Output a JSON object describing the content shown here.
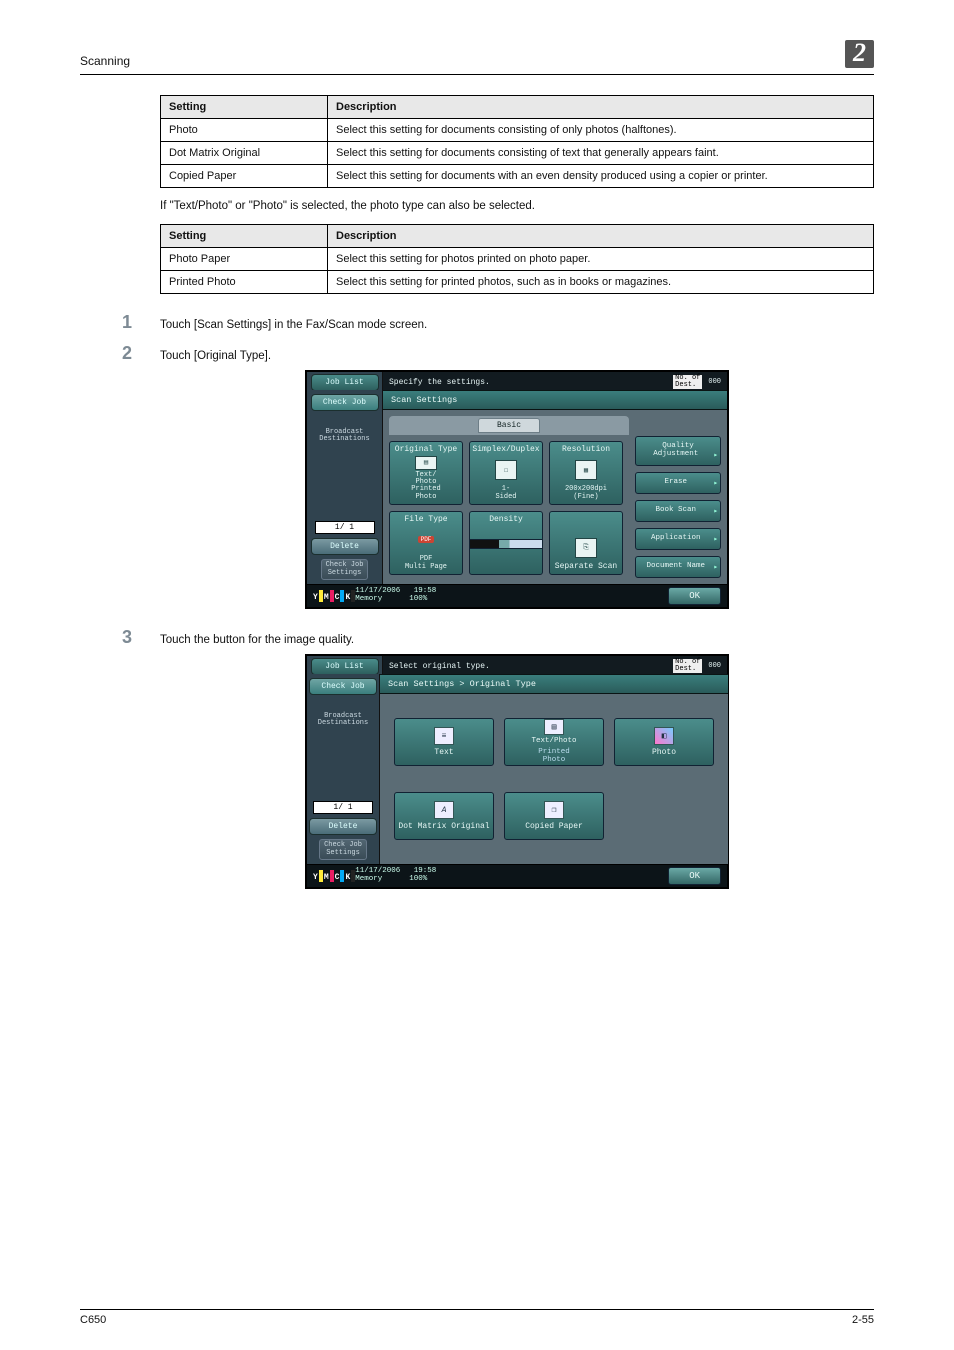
{
  "header": {
    "section": "Scanning",
    "chapter_number": "2"
  },
  "table1": {
    "cols": [
      "Setting",
      "Description"
    ],
    "rows": [
      [
        "Photo",
        "Select this setting for documents consisting of only photos (halftones)."
      ],
      [
        "Dot Matrix Original",
        "Select this setting for documents consisting of text that generally appears faint."
      ],
      [
        "Copied Paper",
        "Select this setting for documents with an even density produced using a copier or printer."
      ]
    ]
  },
  "mid_paragraph": "If \"Text/Photo\" or \"Photo\" is selected, the photo type can also be selected.",
  "table2": {
    "cols": [
      "Setting",
      "Description"
    ],
    "rows": [
      [
        "Photo Paper",
        "Select this setting for photos printed on photo paper."
      ],
      [
        "Printed Photo",
        "Select this setting for printed photos, such as in books or magazines."
      ]
    ]
  },
  "steps": {
    "s1": {
      "num": "1",
      "text": "Touch [Scan Settings] in the Fax/Scan mode screen."
    },
    "s2": {
      "num": "2",
      "text": "Touch [Original Type]."
    },
    "s3": {
      "num": "3",
      "text": "Touch the button for the image quality."
    }
  },
  "screen1": {
    "instruction": "Specify the settings.",
    "no_of_label": "No. of\nDest.",
    "no_of_value": "000",
    "sidebar": {
      "job_list": "Job List",
      "check_job": "Check Job",
      "broadcast": "Broadcast\nDestinations",
      "pager": "1/  1",
      "delete": "Delete",
      "check_settings": "Check Job\nSettings"
    },
    "crumb": "Scan Settings",
    "tab": "Basic",
    "tiles": {
      "original_type": {
        "hdr": "Original Type",
        "sub": "Text/\nPhoto\nPrinted\nPhoto"
      },
      "simplex_duplex": {
        "hdr": "Simplex/Duplex",
        "sub": "1-\nSided"
      },
      "resolution": {
        "hdr": "Resolution",
        "sub": "200x200dpi\n(Fine)"
      },
      "file_type": {
        "hdr": "File Type",
        "badge": "PDF",
        "sub": "PDF\nMulti Page"
      },
      "density": {
        "hdr": "Density"
      },
      "separate": {
        "hdr": "Separate Scan"
      }
    },
    "side_buttons": {
      "quality": "Quality\nAdjustment",
      "erase": "Erase",
      "book": "Book Scan",
      "application": "Application",
      "doc_name": "Document Name"
    },
    "footer": {
      "date": "11/17/2006",
      "time": "19:58",
      "memory": "Memory",
      "mem_val": "100%",
      "ok": "OK"
    },
    "toner": {
      "y": "Y",
      "m": "M",
      "c": "C",
      "k": "K"
    }
  },
  "screen2": {
    "instruction": "Select original type.",
    "no_of_label": "No. of\nDest.",
    "no_of_value": "000",
    "sidebar": {
      "job_list": "Job List",
      "check_job": "Check Job",
      "broadcast": "Broadcast\nDestinations",
      "pager": "1/  1",
      "delete": "Delete",
      "check_settings": "Check Job\nSettings"
    },
    "crumb": "Scan Settings > Original Type",
    "options": {
      "text": "Text",
      "text_photo_upper": "Text/Photo",
      "text_photo_lower": "Printed\nPhoto",
      "photo": "Photo",
      "dot_matrix": "Dot Matrix Original",
      "copied": "Copied Paper"
    },
    "footer": {
      "date": "11/17/2006",
      "time": "19:58",
      "memory": "Memory",
      "mem_val": "100%",
      "ok": "OK"
    },
    "toner": {
      "y": "Y",
      "m": "M",
      "c": "C",
      "k": "K"
    }
  },
  "page_footer": {
    "left": "C650",
    "right": "2-55"
  }
}
